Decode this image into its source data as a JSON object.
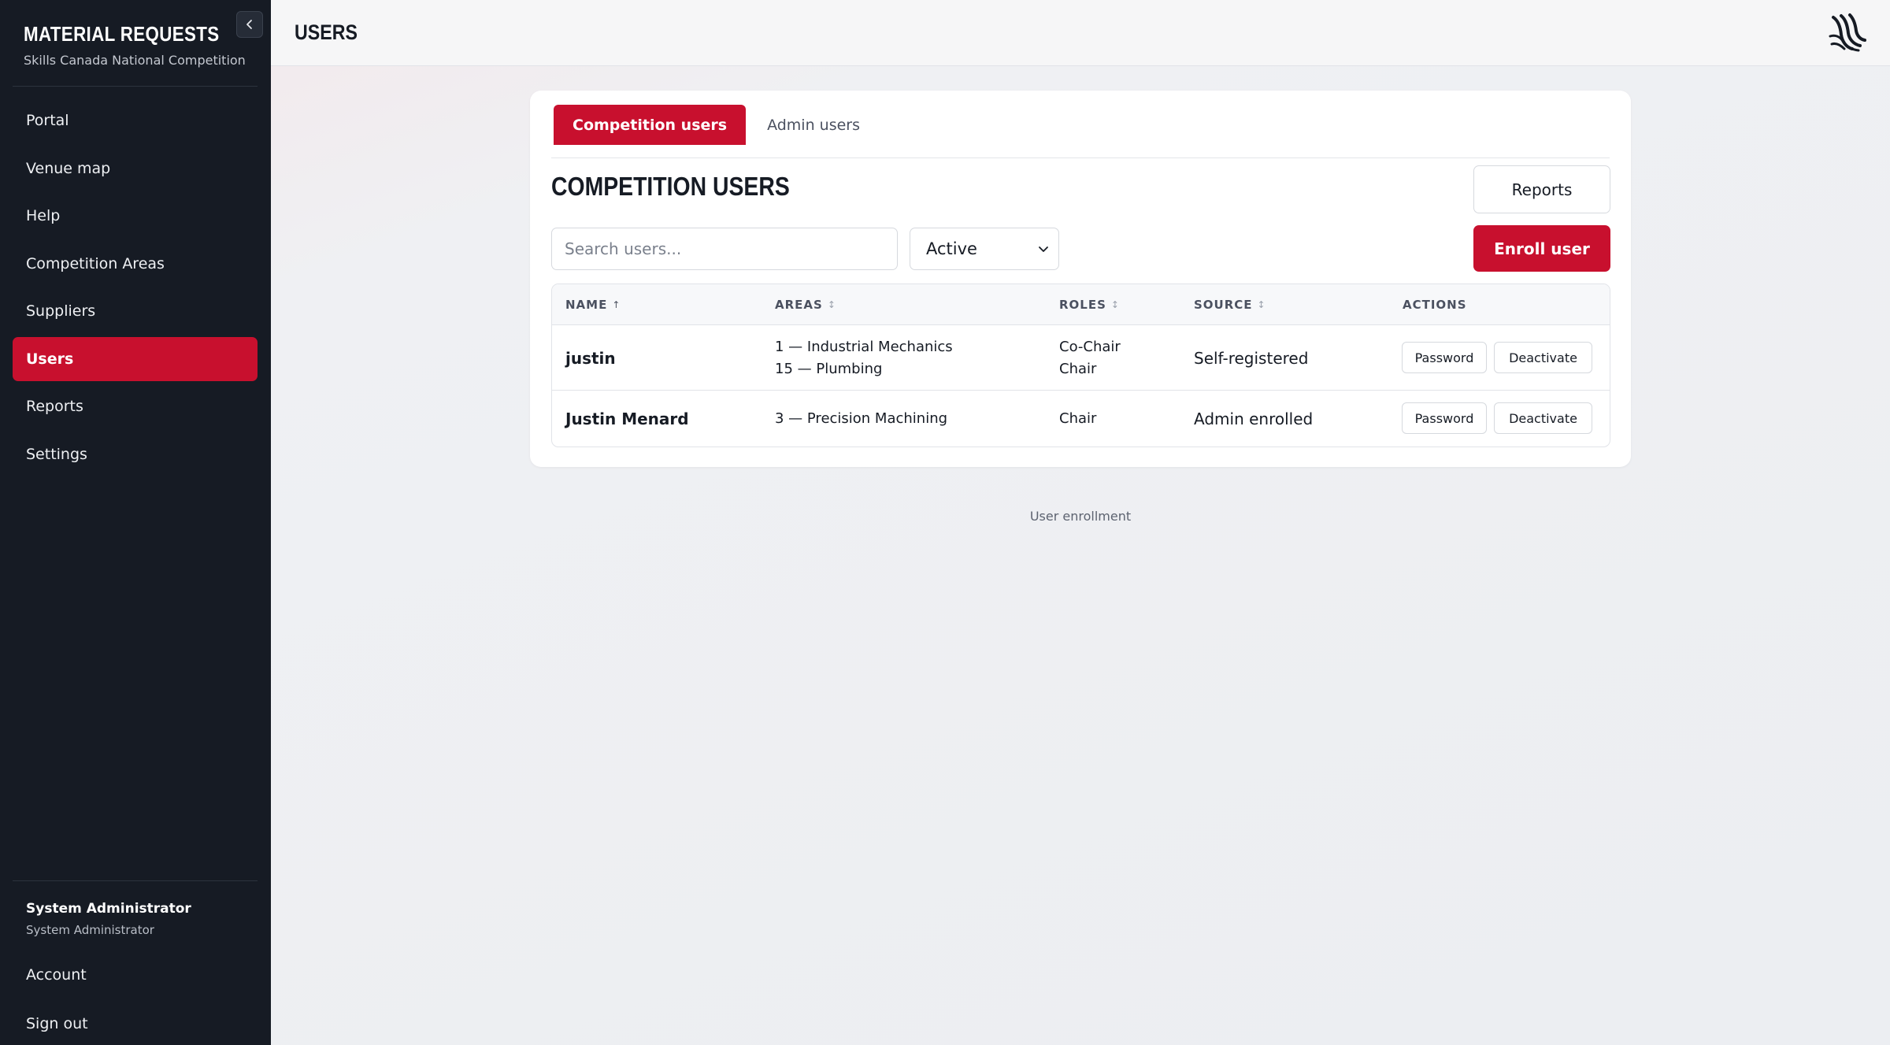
{
  "sidebar": {
    "title": "MATERIAL REQUESTS",
    "subtitle": "Skills Canada National Competition",
    "items": [
      {
        "label": "Portal"
      },
      {
        "label": "Venue map"
      },
      {
        "label": "Help"
      },
      {
        "label": "Competition Areas"
      },
      {
        "label": "Suppliers"
      },
      {
        "label": "Users",
        "active": true
      },
      {
        "label": "Reports"
      },
      {
        "label": "Settings"
      }
    ],
    "user": {
      "name": "System Administrator",
      "role": "System Administrator"
    },
    "account_label": "Account",
    "signout_label": "Sign out"
  },
  "header": {
    "title": "USERS"
  },
  "tabs": [
    {
      "label": "Competition users",
      "active": true
    },
    {
      "label": "Admin users"
    }
  ],
  "main": {
    "title": "COMPETITION USERS",
    "reports_label": "Reports",
    "enroll_label": "Enroll user",
    "search": {
      "placeholder": "Search users...",
      "value": ""
    },
    "filter": {
      "selected": "Active"
    }
  },
  "table": {
    "columns": {
      "name": "NAME",
      "areas": "AREAS",
      "roles": "ROLES",
      "source": "SOURCE",
      "actions": "ACTIONS"
    },
    "sort_glyphs": {
      "name": "↑",
      "other": "↕"
    },
    "rows": [
      {
        "name": "justin",
        "areas": [
          "1 — Industrial Mechanics",
          "15 — Plumbing"
        ],
        "roles": [
          "Co-Chair",
          "Chair"
        ],
        "source": "Self-registered",
        "actions": {
          "password": "Password",
          "deactivate": "Deactivate"
        }
      },
      {
        "name": "Justin Menard",
        "areas": [
          "3 — Precision Machining"
        ],
        "roles": [
          "Chair"
        ],
        "source": "Admin enrolled",
        "actions": {
          "password": "Password",
          "deactivate": "Deactivate"
        }
      }
    ]
  },
  "footer_note": "User enrollment",
  "colors": {
    "accent": "#c8102e",
    "sidebar_bg": "#161b24"
  },
  "icons": {
    "collapse": "chevron-left-icon",
    "logo": "skills-canada-logo",
    "select": "chevron-down-icon"
  }
}
